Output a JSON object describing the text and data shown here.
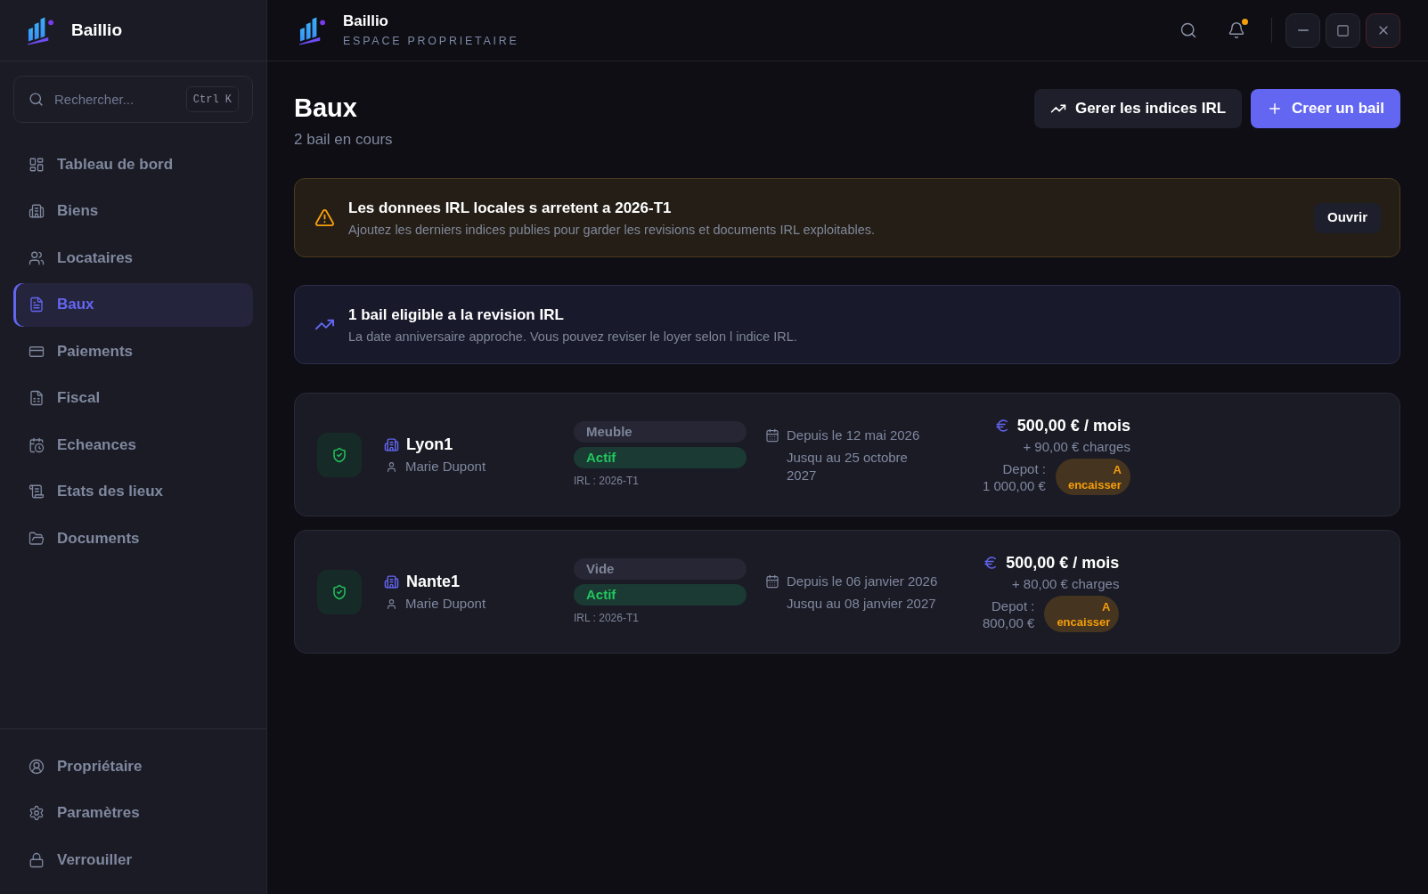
{
  "sidebar": {
    "brand": "Baillio",
    "search": {
      "placeholder": "Rechercher...",
      "shortcut": "Ctrl K"
    },
    "items": [
      {
        "label": "Tableau de bord",
        "selected": false
      },
      {
        "label": "Biens",
        "selected": false
      },
      {
        "label": "Locataires",
        "selected": false
      },
      {
        "label": "Baux",
        "selected": true
      },
      {
        "label": "Paiements",
        "selected": false
      },
      {
        "label": "Fiscal",
        "selected": false
      },
      {
        "label": "Echeances",
        "selected": false
      },
      {
        "label": "Etats des lieux",
        "selected": false
      },
      {
        "label": "Documents",
        "selected": false
      }
    ],
    "footer_items": [
      {
        "label": "Propriétaire",
        "selected": false
      },
      {
        "label": "Paramètres",
        "selected": false
      },
      {
        "label": "Verrouiller",
        "selected": false
      }
    ]
  },
  "header": {
    "title": "Baillio",
    "subtitle": "ESPACE PROPRIETAIRE",
    "notifications": {
      "unread": true
    }
  },
  "page": {
    "title": "Baux",
    "subtitle": "2 bail en cours",
    "actions": [
      {
        "label": "Gerer les indices IRL",
        "kind": "secondary"
      },
      {
        "label": "Creer un bail",
        "kind": "primary"
      }
    ]
  },
  "alerts": [
    {
      "kind": "warning",
      "title": "Les donnees IRL locales s arretent a 2026-T1",
      "text": "Ajoutez les derniers indices publies pour garder les revisions et documents IRL exploitables.",
      "action": "Ouvrir"
    },
    {
      "kind": "info",
      "title": "1 bail eligible a la revision IRL",
      "text": "La date anniversaire approche. Vous pouvez reviser le loyer selon l indice IRL."
    }
  ],
  "leases": [
    {
      "property": "Lyon1",
      "tenant": "Marie Dupont",
      "furnishing": "Meuble",
      "status": "Actif",
      "irl": "IRL : 2026-T1",
      "start": "Depuis le 12 mai 2026",
      "end": "Jusqu au 25 octobre 2027",
      "rent": "500,00 € / mois",
      "charges": "+ 90,00 € charges",
      "deposit_label": "Depot :",
      "deposit": "1 000,00 €",
      "deposit_status": "A encaisser"
    },
    {
      "property": "Nante1",
      "tenant": "Marie Dupont",
      "furnishing": "Vide",
      "status": "Actif",
      "irl": "IRL : 2026-T1",
      "start": "Depuis le 06 janvier 2026",
      "end": "Jusqu au 08 janvier 2027",
      "rent": "500,00 € / mois",
      "charges": "+ 80,00 € charges",
      "deposit_label": "Depot :",
      "deposit": "800,00 €",
      "deposit_status": "A encaisser"
    }
  ]
}
